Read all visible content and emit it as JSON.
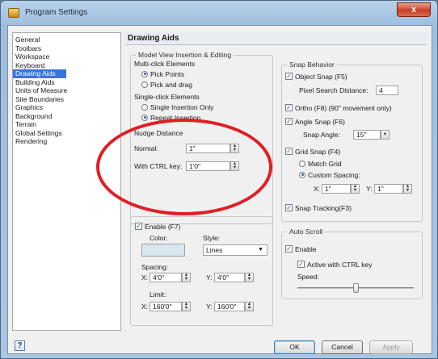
{
  "window": {
    "title": "Program Settings",
    "close_label": "x"
  },
  "nav": {
    "items": [
      "General",
      "Toolbars",
      "Workspace",
      "Keyboard",
      "Drawing Aids",
      "Building Aids",
      "Units of Measure",
      "Site Boundaries",
      "Graphics",
      "Background",
      "Terrain",
      "Global Settings",
      "Rendering"
    ],
    "selected_index": 4
  },
  "panel": {
    "title": "Drawing Aids"
  },
  "model_view": {
    "legend": "Model View Insertion & Editing",
    "multi_click_label": "Multi-click Elements",
    "pick_points": "Pick Points",
    "pick_and_drag": "Pick and drag",
    "single_click_label": "Single-click Elements",
    "single_insertion": "Single Insertion Only",
    "repeat_insertion": "Repeat Insertion",
    "nudge_label": "Nudge Distance",
    "normal_label": "Normal:",
    "normal_value": "1\"",
    "ctrl_label": "With CTRL key:",
    "ctrl_value": "1'0\""
  },
  "grid": {
    "enable_label": "Enable (F7)",
    "color_label": "Color:",
    "style_label": "Style:",
    "style_value": "Lines",
    "spacing_label": "Spacing:",
    "x_label": "X:",
    "y_label": "Y:",
    "spacing_x": "4'0\"",
    "spacing_y": "4'0\"",
    "limit_label": "Limit:",
    "limit_x": "160'0\"",
    "limit_y": "160'0\""
  },
  "snap": {
    "legend": "Snap Behavior",
    "object_snap": "Object Snap (F5)",
    "pixel_label": "Pixel Search Distance:",
    "pixel_value": "4",
    "ortho": "Ortho (F8) (90\" movement only)",
    "angle_snap": "Angle Snap (F6)",
    "snap_angle_label": "Snap Angle:",
    "snap_angle_value": "15\"",
    "grid_snap": "Grid Snap (F4)",
    "match_grid": "Match Grid",
    "custom_spacing": "Custom Spacing:",
    "x_label": "X:",
    "y_label": "Y:",
    "custom_x": "1\"",
    "custom_y": "1\"",
    "snap_tracking": "Snap Tracking(F3)"
  },
  "autoscroll": {
    "legend": "Auto Scroll",
    "enable": "Enable",
    "active_ctrl": "Active with CTRL key",
    "speed_label": "Speed:",
    "speed_fraction": 0.5
  },
  "buttons": {
    "help": "?",
    "ok": "OK",
    "cancel": "Cancel",
    "apply": "Apply"
  },
  "colors": {
    "selection": "#3b74d6",
    "annotation": "#e01e24",
    "titlebar": "#a9c6e2"
  }
}
